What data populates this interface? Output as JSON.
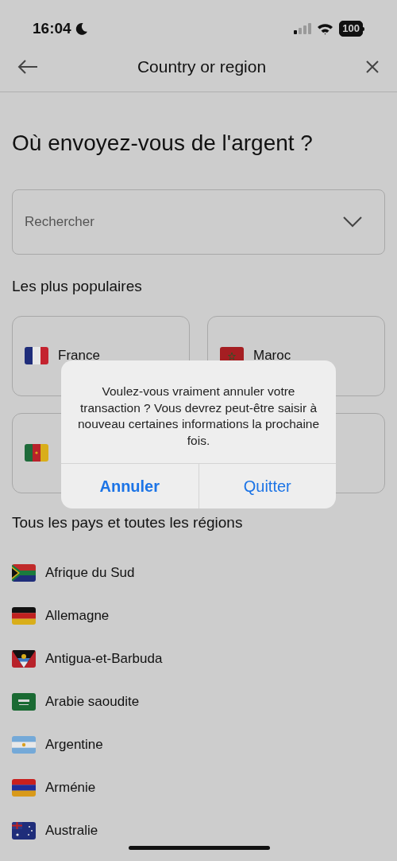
{
  "status_bar": {
    "time": "16:04",
    "battery": "100"
  },
  "header": {
    "title": "Country or region"
  },
  "heading": "Où envoyez-vous de l'argent ?",
  "search": {
    "placeholder": "Rechercher"
  },
  "popular": {
    "title": "Les plus populaires",
    "items": [
      {
        "kind": "card",
        "label": "France"
      },
      {
        "kind": "card",
        "label": "Maroc"
      },
      {
        "kind": "card"
      },
      {
        "kind": "card"
      }
    ]
  },
  "all": {
    "title": "Tous les pays et toutes les régions",
    "items": [
      {
        "label": "Afrique du Sud"
      },
      {
        "label": "Allemagne"
      },
      {
        "label": "Antigua-et-Barbuda"
      },
      {
        "label": "Arabie saoudite"
      },
      {
        "label": "Argentine"
      },
      {
        "label": "Arménie"
      },
      {
        "label": "Australie"
      }
    ]
  },
  "dialog": {
    "message": "Voulez-vous vraiment annuler votre transaction ? Vous devrez peut-être saisir à nouveau certaines informations la prochaine fois.",
    "buttons": [
      {
        "label": "Annuler",
        "primary": true
      },
      {
        "label": "Quitter",
        "primary": false
      }
    ]
  }
}
